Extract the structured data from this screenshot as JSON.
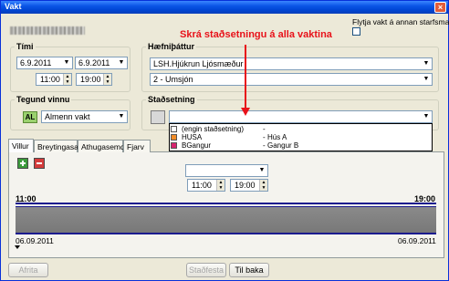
{
  "window": {
    "title": "Vakt",
    "close_glyph": "×"
  },
  "options": {
    "move_shift_label": "Flytja vakt á annan starfsmann",
    "move_shift_checked": false
  },
  "timi": {
    "legend": "Tími",
    "start_date": "6.9.2011",
    "end_date": "6.9.2011",
    "start_time": "11:00",
    "end_time": "19:00"
  },
  "haefni": {
    "legend": "Hæfniþáttur",
    "primary": "LSH.Hjúkrun Ljósmæður",
    "secondary": "2 - Umsjón"
  },
  "tegund": {
    "legend": "Tegund vinnu",
    "badge": "AL",
    "badge_color": "#9bd16e",
    "value": "Almenn vakt"
  },
  "stadsetning": {
    "legend": "Staðsetning",
    "value": "",
    "options": [
      {
        "code": "(engin staðsetning)",
        "dash": "-",
        "name": "",
        "color": "#ffffff"
      },
      {
        "code": "HUSA",
        "dash": "-",
        "name": "Hús A",
        "color": "#f28c28"
      },
      {
        "code": "BGangur",
        "dash": "-",
        "name": "Gangur B",
        "color": "#d6246e"
      }
    ]
  },
  "annotation": {
    "text": "Skrá staðsetningu á alla vaktina",
    "color": "#e8121a"
  },
  "tabs": [
    {
      "label": "Villur",
      "active": true
    },
    {
      "label": "Breytingasaga",
      "active": false
    },
    {
      "label": "Athugasemdir",
      "active": false
    },
    {
      "label": "Fjarv",
      "active": false
    }
  ],
  "panel": {
    "combo_value": "",
    "start_time": "11:00",
    "end_time": "19:00"
  },
  "timeline": {
    "start_label": "11:00",
    "end_label": "19:00",
    "start_date": "06.09.2011",
    "end_date": "06.09.2011"
  },
  "buttons": {
    "afrita": "Afrita",
    "stadfesta": "Staðfesta",
    "til_baka": "Til baka"
  },
  "icons": {
    "close": "close-icon",
    "add": "plus-icon",
    "remove": "minus-icon",
    "dropdown": "chevron-down-icon"
  }
}
